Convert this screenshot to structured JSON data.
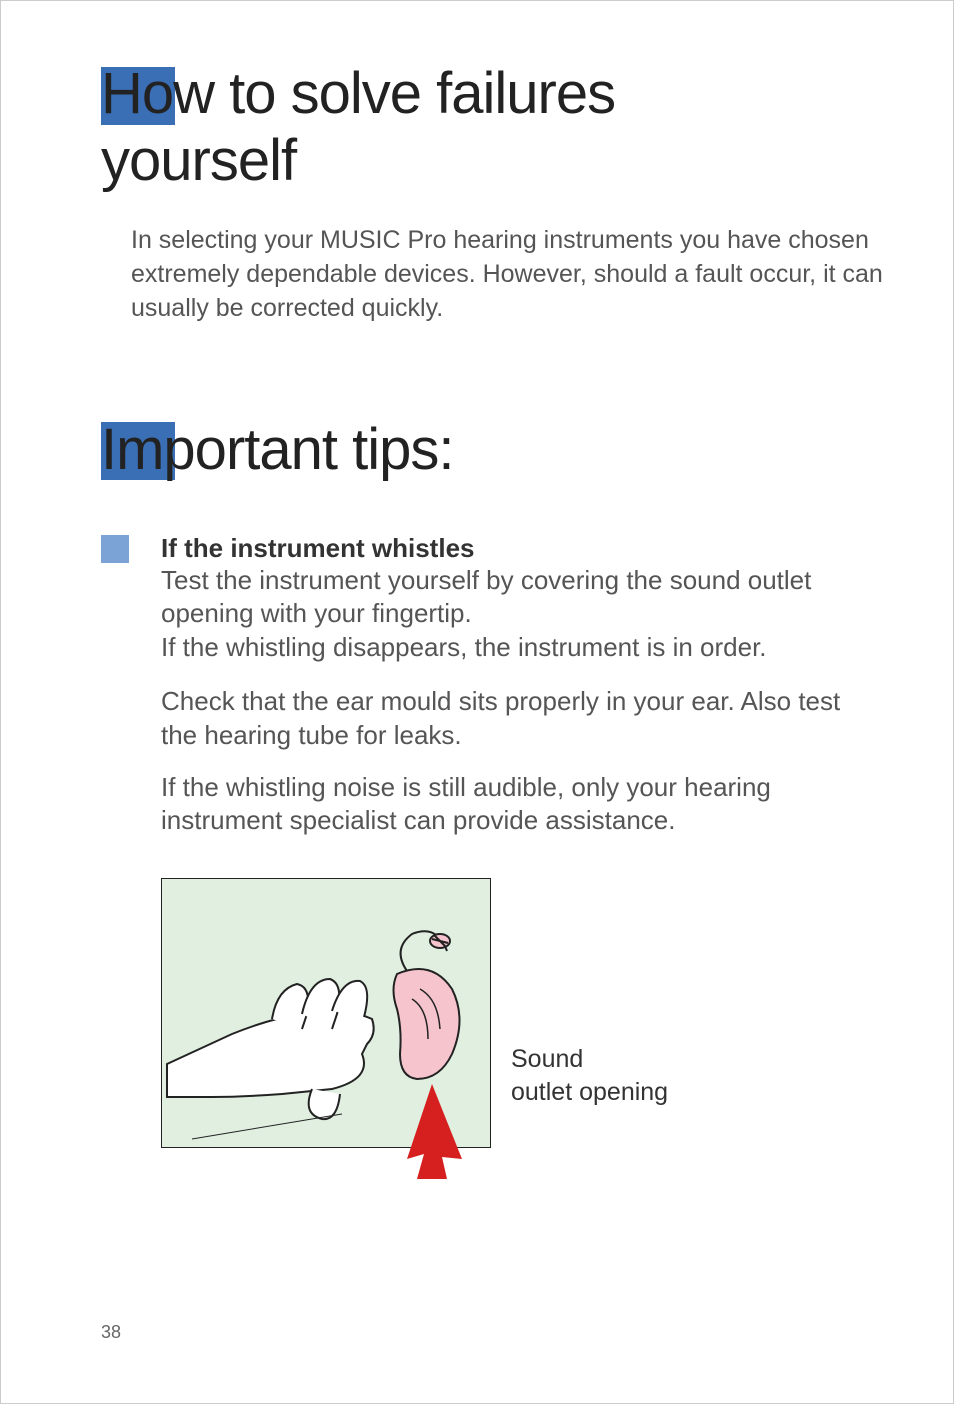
{
  "heading1_line1": "How to solve failures",
  "heading1_line2": "yourself",
  "intro": "In selecting your MUSIC Pro hearing instruments you have chosen extremely dependable devices. However, should a fault occur, it can usually be corrected quickly.",
  "heading2": "Important tips:",
  "tip": {
    "title": "If the instrument whistles",
    "body1": "Test the instrument yourself by covering the sound outlet opening with your fingertip.",
    "body2": "If the whistling disappears, the instrument is in order.",
    "para2": "Check that the ear mould sits properly in your ear. Also test the hearing tube for leaks.",
    "para3": "If the whistling noise is still audible, only your hearing instrument specialist can provide assistance."
  },
  "figure_label_line1": "Sound",
  "figure_label_line2": "outlet opening",
  "page_number": "38"
}
